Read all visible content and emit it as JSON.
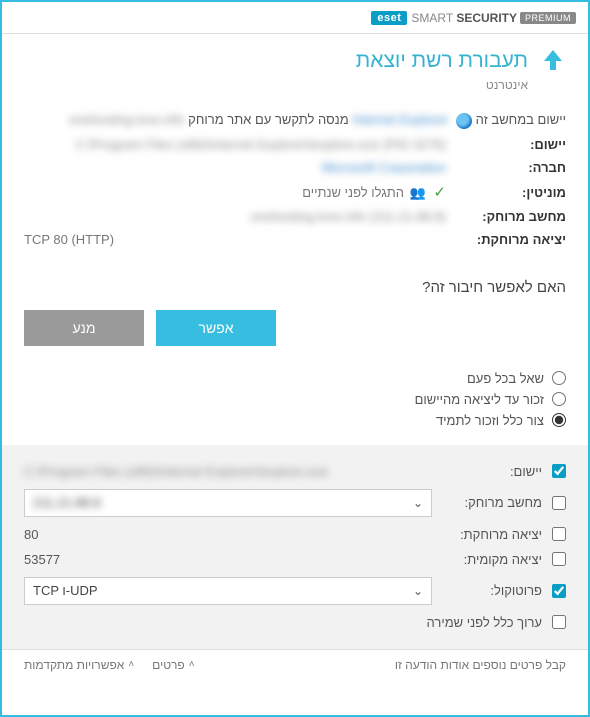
{
  "brand": {
    "logo": "eset",
    "product1": "SMART",
    "product2": "SECURITY",
    "badge": "PREMIUM"
  },
  "title": "תעבורת רשת יוצאת",
  "subtitle": "אינטרנט",
  "info": {
    "app_line_prefix": "יישום במחשב זה",
    "app_name_blur": "Internet Explorer",
    "app_line_suffix": "מנסה לתקשר עם אתר מרוחק",
    "site_blur": "onehosting.love.info",
    "labels": {
      "app": "יישום:",
      "company": "חברה:",
      "reputation": "מוניטין:",
      "remote_host": "מחשב מרוחק:",
      "remote_port": "יציאה מרוחקת:"
    },
    "app_path_blur": "(PID 3276) C:\\Program Files (x86)\\Internet Explorer\\iexplore.exe",
    "company_blur": "Microsoft Corporation",
    "reputation": "התגלו לפני שנתיים",
    "remote_host_blur": "onehosting.love.info (211.21.88.8)",
    "remote_port": "TCP 80 (HTTP)"
  },
  "question": "האם לאפשר חיבור זה?",
  "buttons": {
    "allow": "אפשר",
    "deny": "מנע"
  },
  "radios": {
    "ask": "שאל בכל פעם",
    "remember_app": "זכור עד ליציאה מהיישום",
    "create_rule": "צור כלל וזכור לתמיד"
  },
  "rule": {
    "labels": {
      "app": "יישום:",
      "remote_host": "מחשב מרוחק:",
      "remote_port": "יציאה מרוחקת:",
      "local_port": "יציאה מקומית:",
      "protocol": "פרוטוקול:",
      "edit": "ערוך כלל לפני שמירה"
    },
    "app_path_blur": "C:\\Program Files (x86)\\Internet Explorer\\iexplore.exe",
    "remote_host_blur": "211.21.88.8",
    "remote_port": "80",
    "local_port": "53577",
    "protocol": "TCP ו-UDP"
  },
  "footer": {
    "more_info": "קבל פרטים נוספים אודות הודעה זו",
    "details": "פרטים",
    "advanced": "אפשרויות מתקדמות"
  }
}
